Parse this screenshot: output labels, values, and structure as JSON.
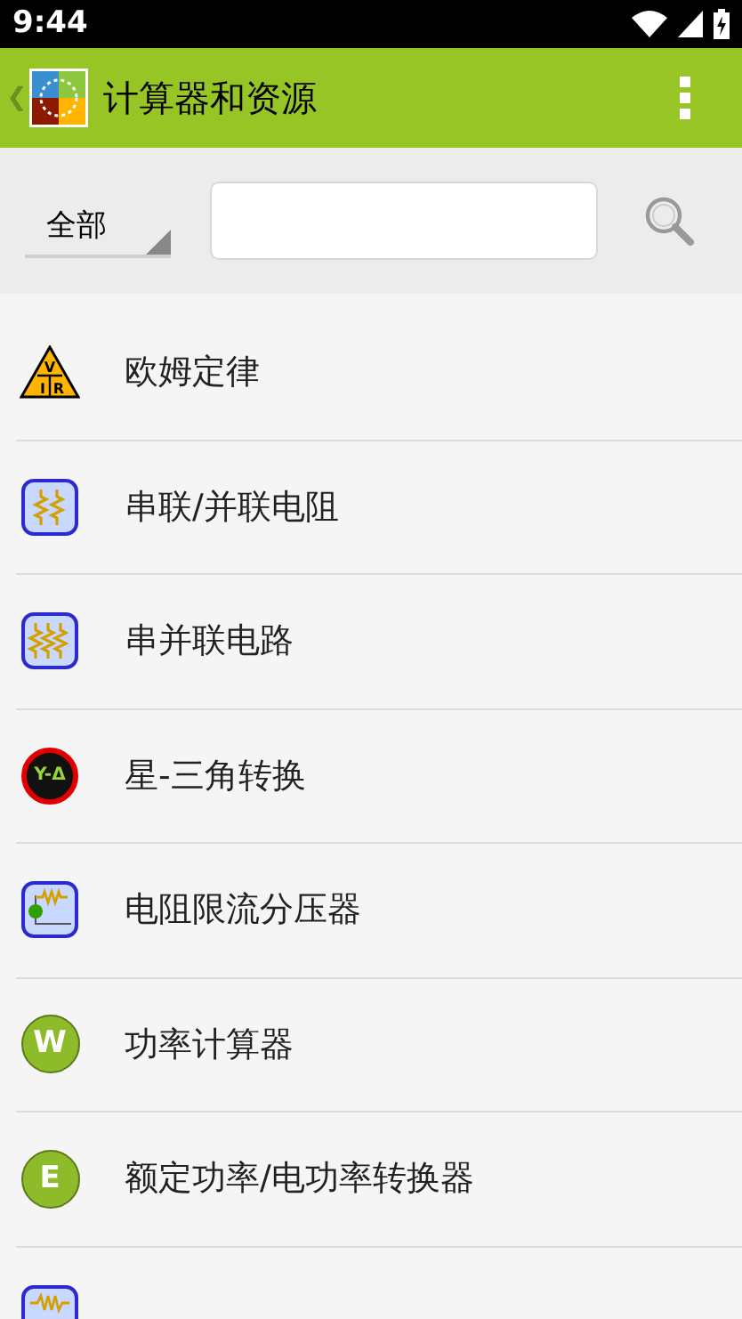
{
  "status_bar": {
    "time": "9:44"
  },
  "app_bar": {
    "back": "❮",
    "title": "计算器和资源"
  },
  "filter": {
    "category": "全部"
  },
  "items": [
    {
      "kind": "triangle",
      "icon_text": [
        "V",
        "I",
        "R"
      ],
      "label": "欧姆定律"
    },
    {
      "kind": "resistors2",
      "label": "串联/并联电阻"
    },
    {
      "kind": "resistors3",
      "label": "串并联电路"
    },
    {
      "kind": "badge_red",
      "icon_text": [
        "Y-Δ"
      ],
      "label": "星-三角转换"
    },
    {
      "kind": "divider_circuit",
      "label": "电阻限流分压器"
    },
    {
      "kind": "badge_green",
      "icon_text": [
        "W"
      ],
      "label": "功率计算器"
    },
    {
      "kind": "badge_green",
      "icon_text": [
        "E"
      ],
      "label": "额定功率/电功率转换器"
    },
    {
      "kind": "series_divider"
    }
  ]
}
